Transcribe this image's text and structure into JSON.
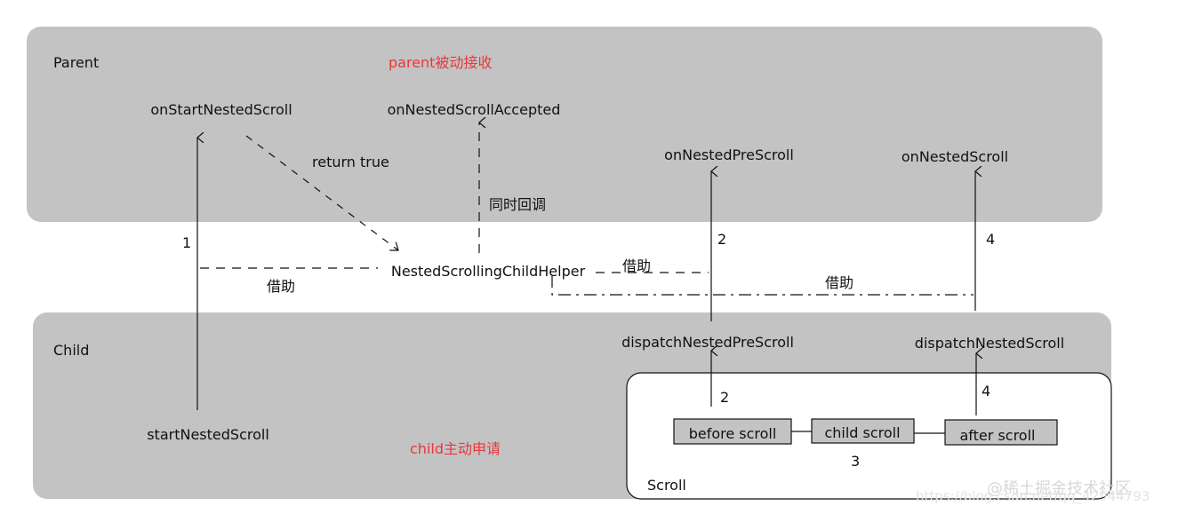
{
  "colors": {
    "panel": "#c3c3c3",
    "accent": "#e8383d",
    "line": "#111111"
  },
  "parent": {
    "label": "Parent",
    "note": "parent被动接收",
    "on_start": "onStartNestedScroll",
    "on_accepted": "onNestedScrollAccepted",
    "on_pre_scroll": "onNestedPreScroll",
    "on_scroll": "onNestedScroll"
  },
  "edges": {
    "return_true": "return true",
    "callback": "同时回调",
    "step1": "1",
    "step2": "2",
    "step4": "4",
    "borrow_left": "借助",
    "borrow_mid": "借助",
    "borrow_right": "借助",
    "step2b": "2",
    "step4b": "4",
    "step3": "3"
  },
  "helper": "NestedScrollingChildHelper",
  "child": {
    "label": "Child",
    "note": "child主动申请",
    "start": "startNestedScroll",
    "dispatch_pre": "dispatchNestedPreScroll",
    "dispatch": "dispatchNestedScroll"
  },
  "scroll": {
    "label": "Scroll",
    "before": "before scroll",
    "child": "child scroll",
    "after": "after scroll"
  },
  "watermark": {
    "main": "@稀土掘金技术社区",
    "url": "https://blog.csdn.net/qq_42944793"
  }
}
